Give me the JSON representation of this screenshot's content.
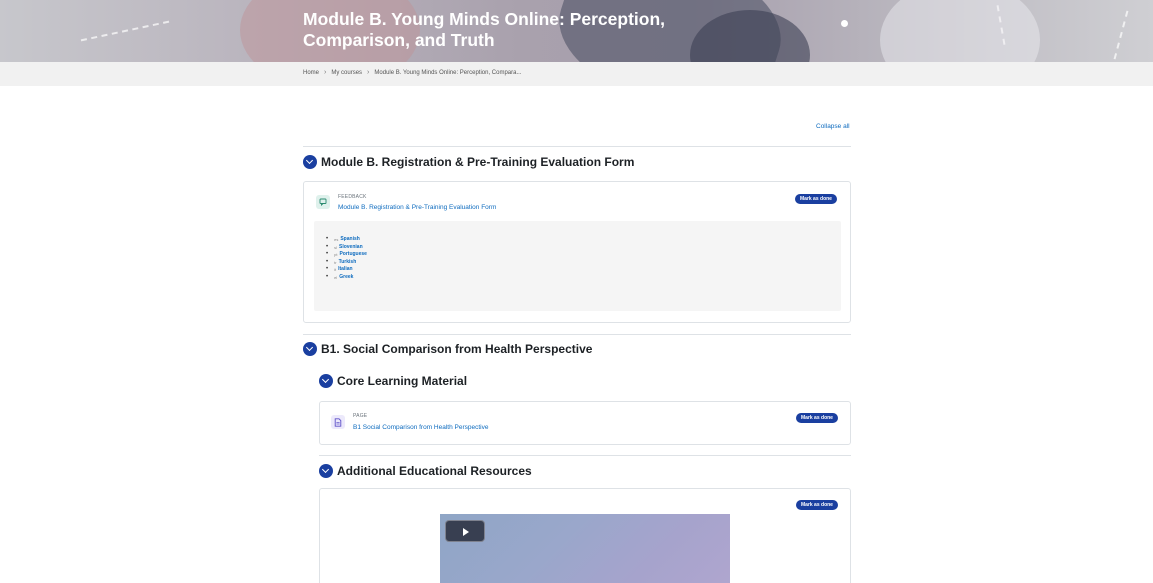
{
  "header": {
    "course_title": "Module B. Young Minds Online: Perception, Comparison, and Truth"
  },
  "breadcrumb": {
    "items": [
      "Home",
      "My courses",
      "Module B. Young Minds Online: Perception, Compara..."
    ]
  },
  "collapse_all": "Collapse all",
  "sections": [
    {
      "title": "Module B. Registration & Pre-Training Evaluation Form",
      "activity": {
        "type": "FEEDBACK",
        "name": "Module B. Registration & Pre-Training Evaluation Form",
        "mark_label": "Mark as done",
        "icon": "feedback-icon"
      },
      "languages": [
        {
          "code": "es",
          "name": "Spanish"
        },
        {
          "code": "sl",
          "name": "Slovenian"
        },
        {
          "code": "pt",
          "name": "Portuguese"
        },
        {
          "code": "tr",
          "name": "Turkish"
        },
        {
          "code": "it",
          "name": "Italian"
        },
        {
          "code": "el",
          "name": "Greek"
        }
      ]
    },
    {
      "title": "B1. Social Comparison from Health Perspective",
      "subsections": [
        {
          "title": "Core Learning Material",
          "activity": {
            "type": "PAGE",
            "name": "B1 Social Comparison from Health Perspective",
            "mark_label": "Mark as done",
            "icon": "page-icon"
          }
        },
        {
          "title": "Additional Educational Resources",
          "activity": {
            "mark_label": "Mark as done",
            "icon": "play-icon"
          }
        }
      ]
    }
  ],
  "colors": {
    "accent": "#1a3fa0",
    "link": "#0f6cbf",
    "breadcrumb_bg": "#f1f1f1"
  }
}
